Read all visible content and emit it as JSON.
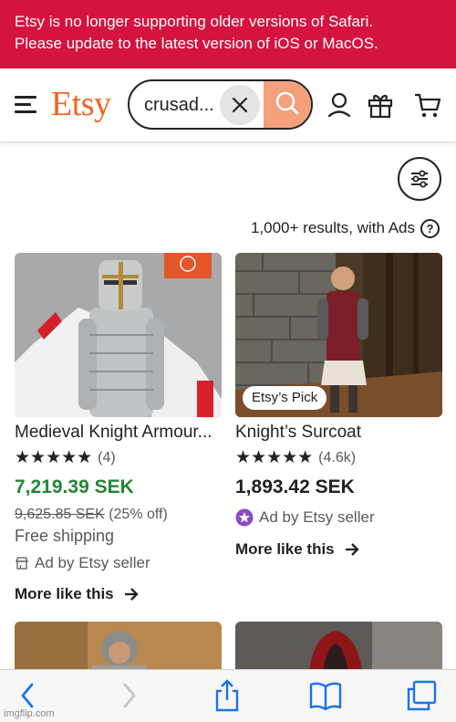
{
  "banner": {
    "line1": "Etsy is no longer supporting older versions of Safari.",
    "line2": "Please update to the latest version of iOS or MacOS."
  },
  "header": {
    "logo": "Etsy",
    "search_value": "crusad..."
  },
  "results": {
    "text": "1,000+ results, with Ads",
    "help_glyph": "?"
  },
  "listings": [
    {
      "title": "Medieval Knight Armour...",
      "stars": "★★★★★",
      "review_count": "(4)",
      "price": "7,219.39 SEK",
      "price_color": "#258635",
      "old_price": "9,625.85 SEK",
      "discount": "(25% off)",
      "shipping": "Free shipping",
      "ad_label": "Ad by Etsy seller",
      "more_label": "More like this"
    },
    {
      "badge": "Etsy’s Pick",
      "title": "Knight’s Surcoat",
      "stars": "★★★★★",
      "review_count": "(4.6k)",
      "price": "1,893.42 SEK",
      "ad_label": "Ad by Etsy seller",
      "more_label": "More like this"
    }
  ],
  "watermark": "imgflip.com",
  "colors": {
    "banner": "#d5133f",
    "brand_orange": "#f1641e",
    "search_button": "#f4a07a",
    "sale_price": "#258635",
    "star_seller": "#8a4cc1"
  }
}
